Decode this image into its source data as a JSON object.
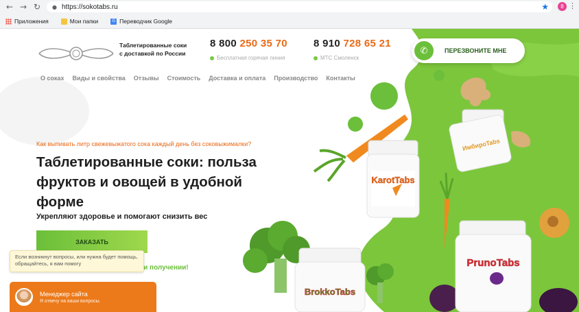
{
  "browser": {
    "url": "https://sokotabs.ru",
    "profile_initial": "8",
    "bookmarks": [
      "Приложения",
      "Мои папки",
      "Переводчик Google"
    ]
  },
  "header": {
    "tagline_line1": "Таблетированные соки",
    "tagline_line2": "с доставкой по России",
    "phone1_prefix": "8 800",
    "phone1_main": "250 35 70",
    "phone1_sub": "Бесплатная горячая линия",
    "phone2_prefix": "8 910",
    "phone2_main": "728 65 21",
    "phone2_sub": "МТС Смоленск",
    "callback_label": "ПЕРЕЗВОНИТЕ МНЕ"
  },
  "nav": [
    "О соках",
    "Виды и свойства",
    "Отзывы",
    "Стоимость",
    "Доставка и оплата",
    "Производство",
    "Контакты"
  ],
  "hero": {
    "question": "Как выпивать литр свежевыжатого сока каждый день без соковыжималки?",
    "title": "Таблетированные соки: польза фруктов и овощей в удобной форме",
    "subtitle": "Укрепляют здоровье и помогают снизить вес",
    "order_button": "ЗАКАЗАТЬ",
    "receipt_text": "ри получении!"
  },
  "products": {
    "jar1": "KarotTabs",
    "jar2": "ИмбироTabs",
    "jar3": "PrunoTabs",
    "jar4": "BrokkoTabs"
  },
  "chat": {
    "tip": "Если возникнут вопросы, или нужна будет помощь, обращайтесь, я вам помогу",
    "title": "Менеджер сайта",
    "subtitle": "Я отвечу на ваши вопросы."
  },
  "colors": {
    "accent_green": "#6bbf3a",
    "accent_orange": "#ea6a17",
    "chat_orange": "#ec7a1a"
  }
}
